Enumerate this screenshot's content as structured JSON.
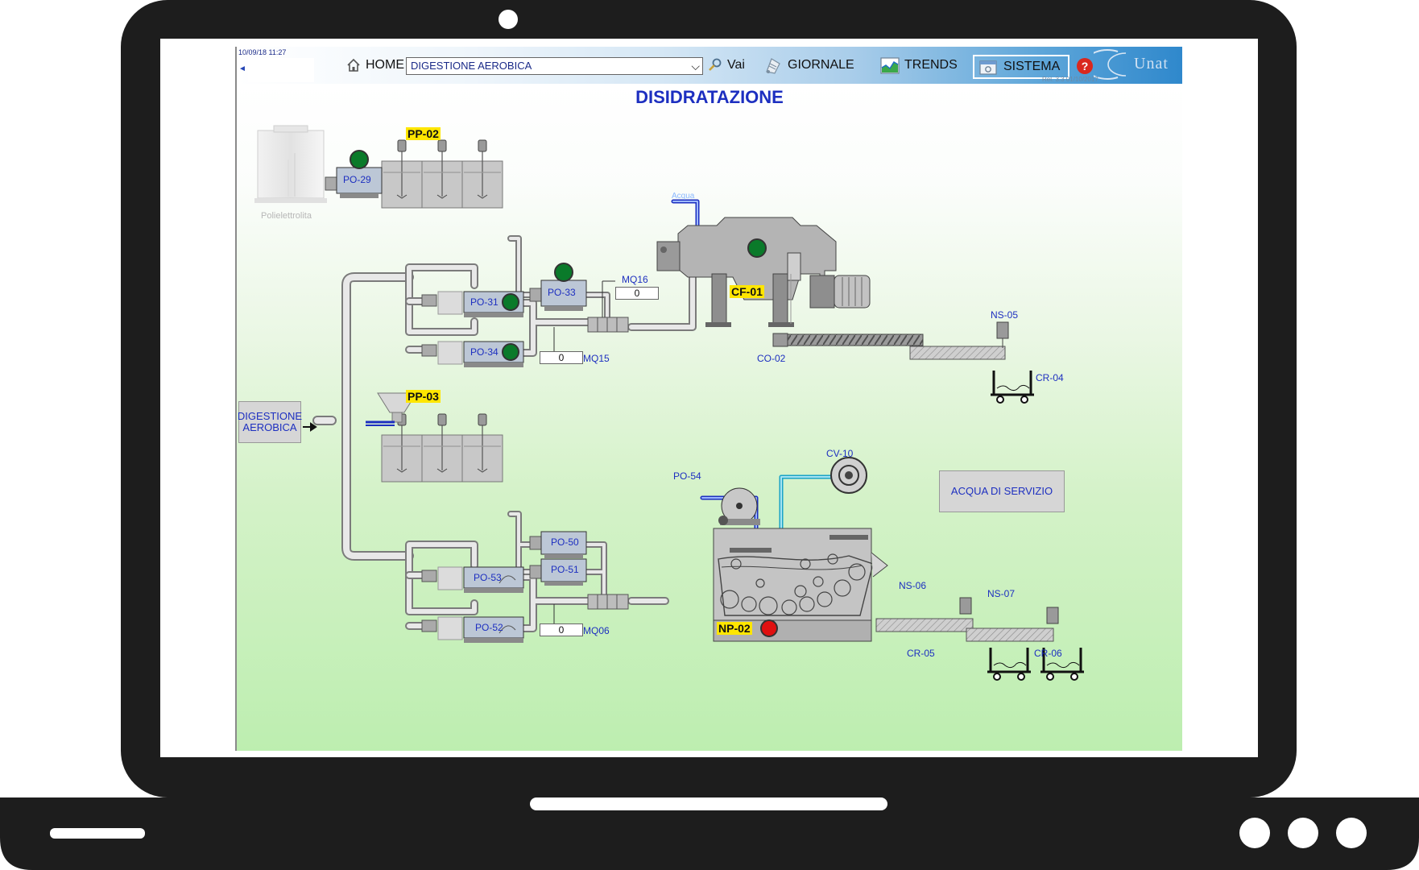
{
  "toolbar": {
    "datetime": "10/09/18 11:27",
    "home_label": "HOME",
    "selected_area": "DIGESTIONE AEROBICA",
    "go_label": "Vai",
    "journal_label": "GIORNALE",
    "trends_label": "TRENDS",
    "system_label": "SISTEMA",
    "version": "Rel. 3.3 01/10/2017",
    "logo_text": "Unat"
  },
  "page": {
    "title": "DISIDRATAZIONE"
  },
  "line1": {
    "tank_label": "Polielettrolita",
    "prep_tag": "PP-02",
    "pumps": [
      "PO-29",
      "PO-33",
      "PO-31",
      "PO-34"
    ],
    "flowmeter_16": {
      "label": "MQ16",
      "value": "0"
    },
    "flowmeter_15": {
      "label": "MQ15",
      "value": "0"
    },
    "water_label": "Acqua",
    "centrifuge_tag": "CF-01",
    "conveyor": "CO-02",
    "screw": "NS-05",
    "container": "CR-04"
  },
  "line2": {
    "inlet_button": "DIGESTIONE AEROBICA",
    "prep_tag": "PP-03",
    "pumps": [
      "PO-50",
      "PO-51",
      "PO-53",
      "PO-52"
    ],
    "flowmeter_06": {
      "label": "MQ06",
      "value": "0"
    },
    "water_pump": "PO-54",
    "fan": "CV-10",
    "press_tag": "NP-02",
    "screws": [
      "NS-06",
      "NS-07"
    ],
    "containers": [
      "CR-05",
      "CR-06"
    ],
    "service_water_button": "ACQUA DI SERVIZIO"
  },
  "colors": {
    "status_running": "#0a7a2a",
    "status_alarm": "#e01010",
    "title_blue": "#1d2fc0",
    "tag_yellow": "#ffe600"
  }
}
